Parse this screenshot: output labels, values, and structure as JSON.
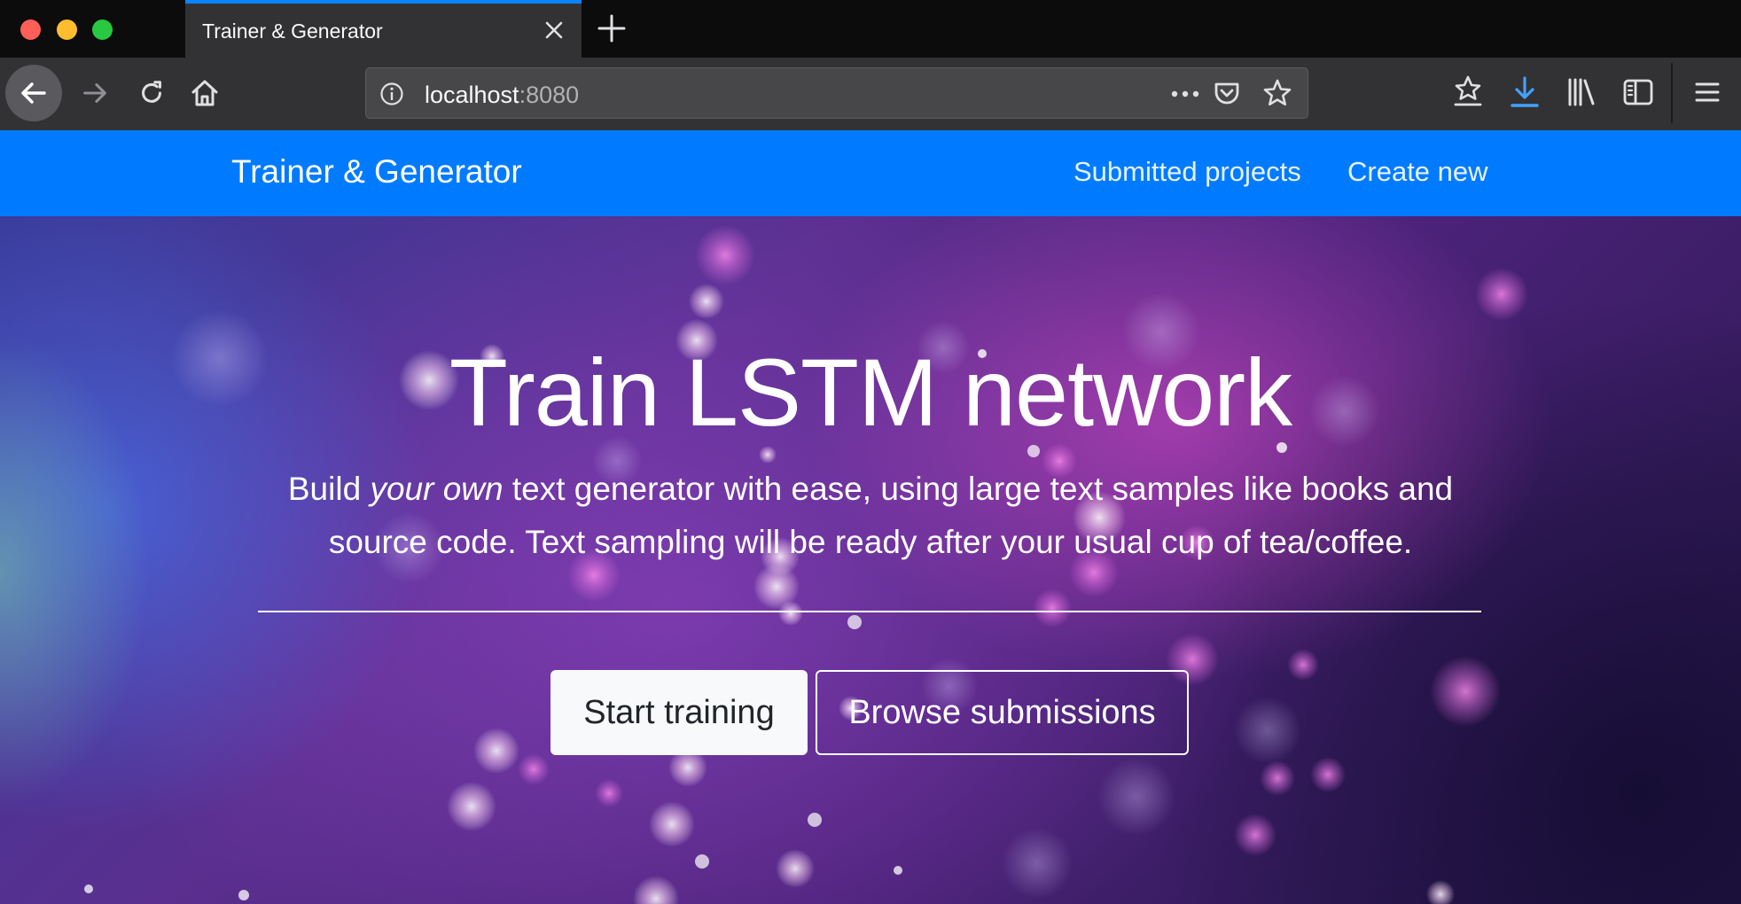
{
  "browser": {
    "tab": {
      "title": "Trainer & Generator"
    },
    "url": {
      "host": "localhost",
      "port": ":8080"
    }
  },
  "site": {
    "brand": "Trainer & Generator",
    "nav": {
      "submitted": "Submitted projects",
      "create": "Create new"
    }
  },
  "hero": {
    "title": "Train LSTM network",
    "lead_before": "Build ",
    "lead_emphasis": "your own",
    "lead_after": " text generator with ease, using large text samples like books and source code. Text sampling will be ready after your usual cup of tea/coffee.",
    "primary_button": "Start training",
    "secondary_button": "Browse submissions"
  },
  "colors": {
    "accent": "#0a84ff",
    "site_navbar": "#007bff",
    "download_icon": "#45a1ff",
    "traffic_close": "#fe5f57",
    "traffic_minimize": "#febc2e",
    "traffic_zoom": "#28c840"
  }
}
